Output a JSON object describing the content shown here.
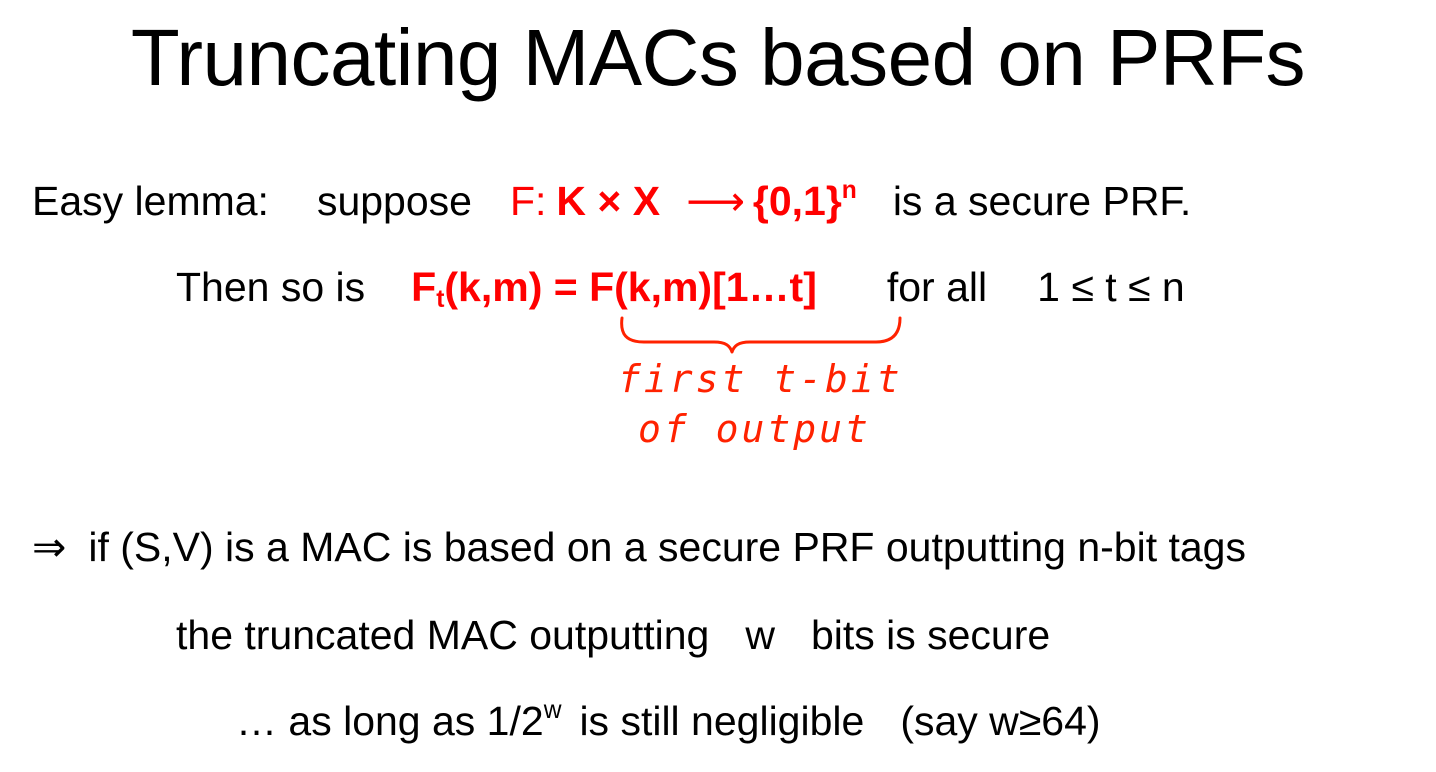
{
  "slide": {
    "title": "Truncating MACs based on PRFs",
    "lemma": {
      "label": "Easy lemma:",
      "suppose": "suppose",
      "f_prefix": "F:",
      "f_domain": "K × X",
      "arrow": "⟶",
      "f_range": "{0,1}",
      "f_range_sup": "n",
      "tail": "is a secure PRF."
    },
    "then": {
      "prefix": "Then so is",
      "ft_F": "F",
      "ft_sub": "t",
      "ft_rest": "(k,m) = F(k,m)[1…t]",
      "for_all": "for all",
      "range": "1 ≤ t ≤ n"
    },
    "annotation": {
      "line1": "first t-bit",
      "line2": "of output"
    },
    "implies": {
      "arrow": "⇒",
      "text": "if  (S,V)  is a MAC is based on a secure PRF outputting n-bit tags"
    },
    "truncated": {
      "pre": "the truncated MAC outputting",
      "var": "w",
      "post": "bits is secure"
    },
    "aslong": {
      "pre": "… as long as  1/2",
      "sup": "w",
      "mid": "is still negligible",
      "paren": "(say  w≥64)"
    },
    "colors": {
      "accent": "#ff0000",
      "text": "#000000",
      "background": "#ffffff"
    }
  }
}
